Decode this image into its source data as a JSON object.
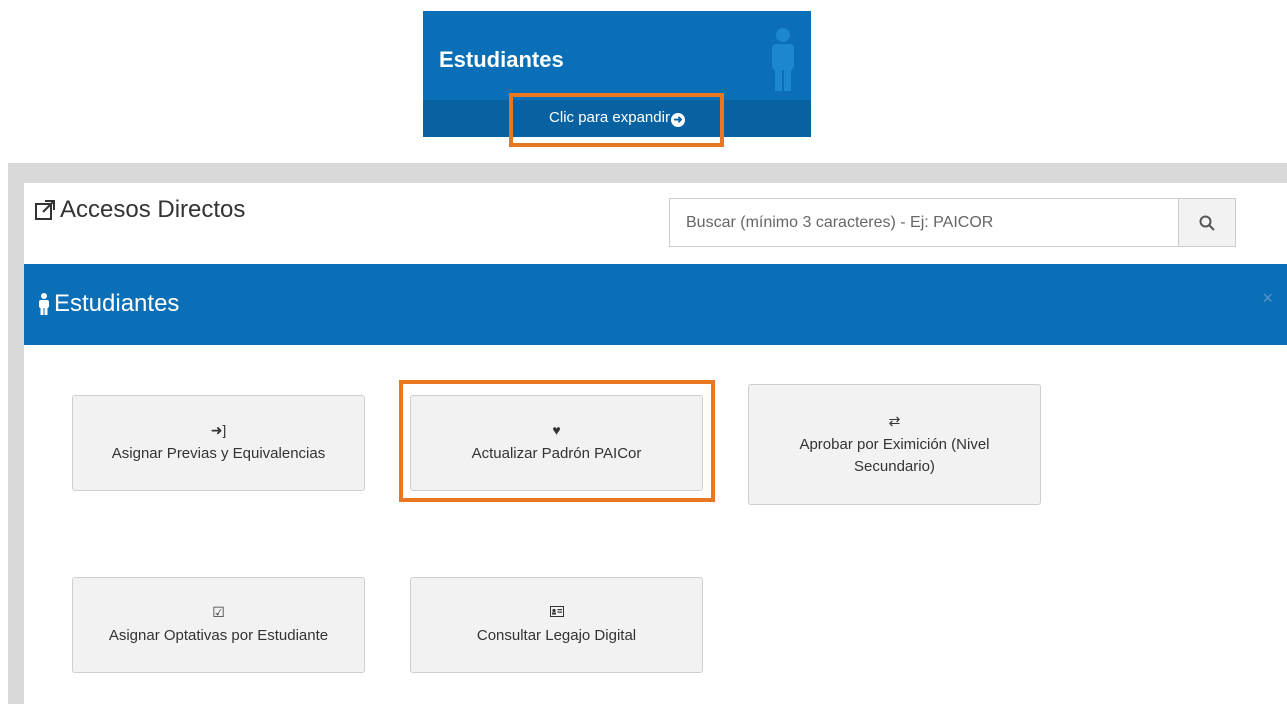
{
  "tile": {
    "title": "Estudiantes",
    "expand_label": "Clic para expandir",
    "icon": "person-icon",
    "arrow_icon": "arrow-circle-right-icon"
  },
  "panel": {
    "title": "Accesos Directos",
    "title_icon": "external-link-icon",
    "search_placeholder": "Buscar (mínimo 3 caracteres) - Ej: PAICOR",
    "search_icon": "search-icon"
  },
  "section": {
    "title": "Estudiantes",
    "icon": "person-icon",
    "close": "×"
  },
  "buttons": [
    {
      "label": "Asignar Previas y Equivalencias",
      "icon": "sign-in-icon",
      "glyph": "➜]"
    },
    {
      "label": "Actualizar Padrón PAICor",
      "icon": "heart-icon",
      "glyph": "♥"
    },
    {
      "label": "Aprobar por Eximición (Nivel Secundario)",
      "icon": "exchange-icon",
      "glyph": "⇄"
    },
    {
      "label": "Asignar Optativas por Estudiante",
      "icon": "check-square-icon",
      "glyph": "☑"
    },
    {
      "label": "Consultar Legajo Digital",
      "icon": "id-card-icon",
      "glyph": "🪪"
    }
  ],
  "colors": {
    "primary": "#0a6fb6",
    "highlight": "#e87722"
  }
}
